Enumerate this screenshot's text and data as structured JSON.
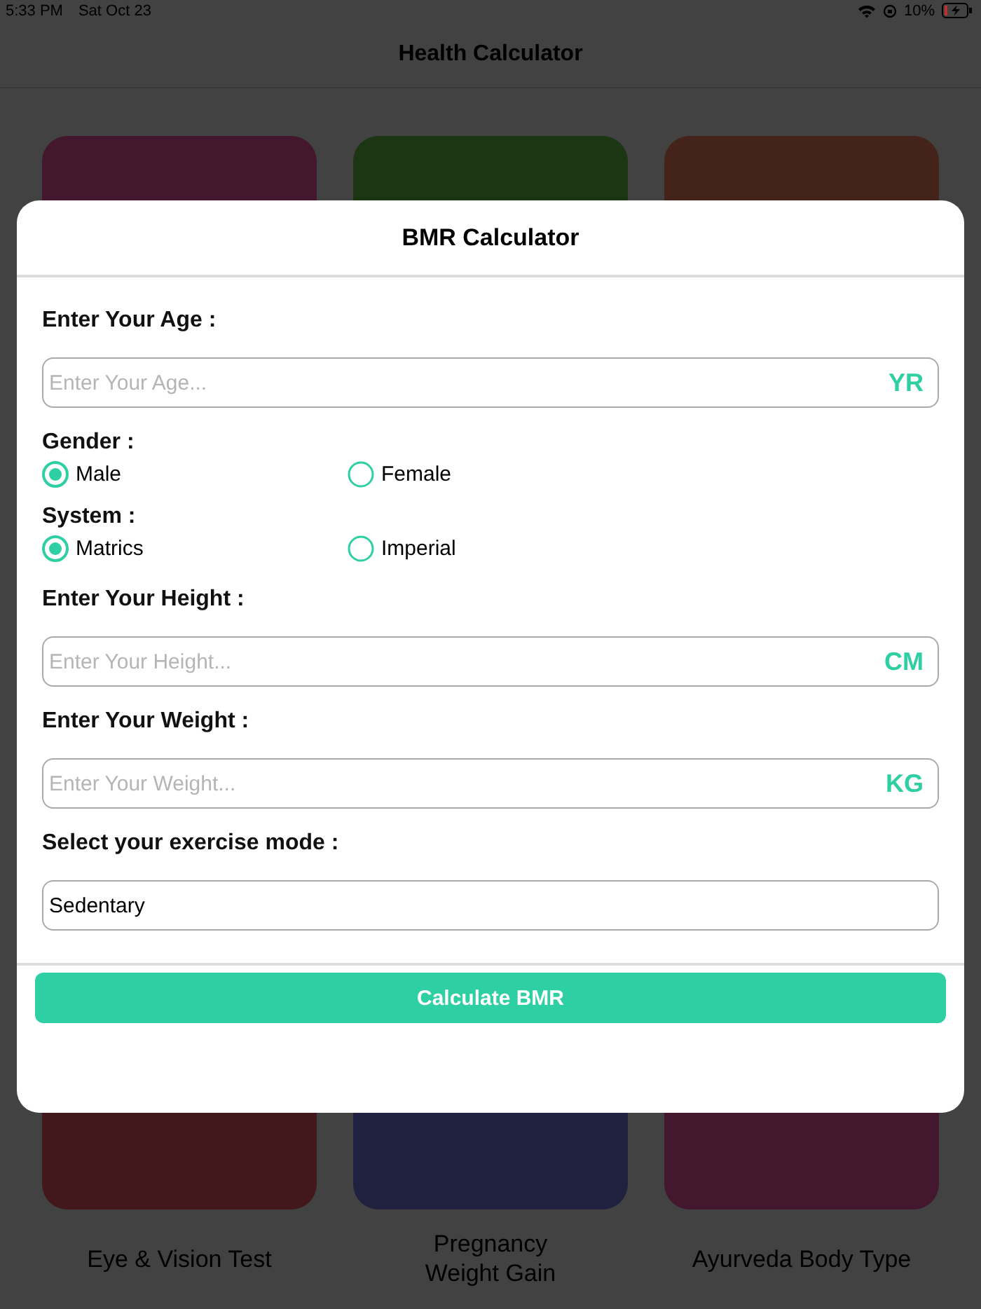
{
  "status_bar": {
    "time": "5:33 PM",
    "date": "Sat Oct 23",
    "battery_percent": "10%"
  },
  "header": {
    "title": "Health Calculator"
  },
  "tiles": [
    {
      "color": "#43182f"
    },
    {
      "color": "#1c3512"
    },
    {
      "color": "#43231a"
    },
    {
      "color": "#43181c",
      "label": "Eye & Vision Test"
    },
    {
      "color": "#20213f",
      "label": "Pregnancy Weight Gain"
    },
    {
      "color": "#43182f",
      "label": "Ayurveda Body Type"
    }
  ],
  "dialog": {
    "title": "BMR Calculator",
    "sections": [
      {
        "kind": "input",
        "label": "Enter Your Age :",
        "placeholder": "Enter Your Age...",
        "unit": "YR"
      },
      {
        "kind": "radio",
        "label": "Gender :",
        "options": [
          {
            "label": "Male",
            "selected": true
          },
          {
            "label": "Female",
            "selected": false
          }
        ]
      },
      {
        "kind": "radio",
        "label": "System :",
        "options": [
          {
            "label": "Matrics",
            "selected": true
          },
          {
            "label": "Imperial",
            "selected": false
          }
        ]
      },
      {
        "kind": "input",
        "label": "Enter Your Height :",
        "placeholder": "Enter Your Height...",
        "unit": "CM"
      },
      {
        "kind": "input",
        "label": "Enter Your Weight :",
        "placeholder": "Enter Your Weight...",
        "unit": "KG"
      },
      {
        "kind": "select",
        "label": "Select your exercise mode :",
        "value": "Sedentary"
      }
    ],
    "button": "Calculate BMR"
  }
}
